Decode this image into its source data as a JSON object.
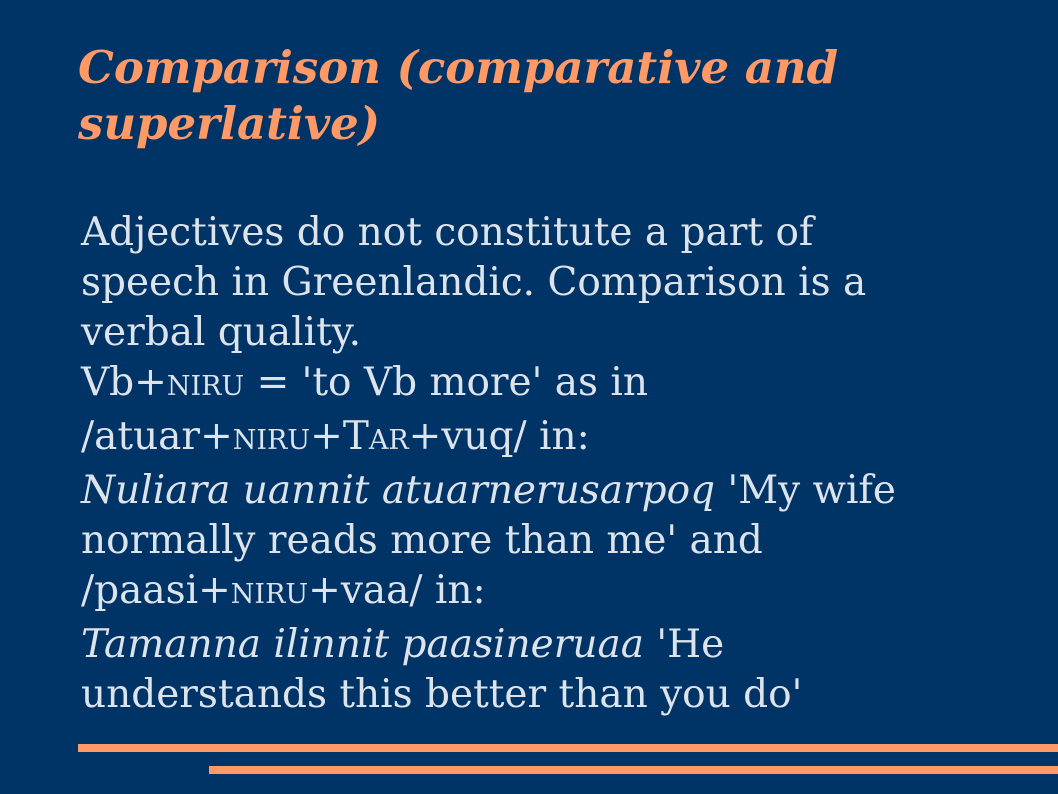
{
  "slide": {
    "title_line1": "Comparison (comparative and",
    "title_line2": "superlative)",
    "body": {
      "l1": "Adjectives do not constitute a part of",
      "l2": "speech in Greenlandic. Comparison is a",
      "l3": "verbal quality.",
      "l4": {
        "a": "Vb+",
        "b": "NIRU",
        "c": " = 'to Vb more' as in"
      },
      "l5": {
        "a": "/atuar+",
        "b": "NIRU",
        "c": "+T",
        "d": "AR",
        "e": "+vuq/ in:"
      },
      "l6": {
        "it": "Nuliara uannit atuarnerusarpoq",
        "rest": " 'My wife"
      },
      "l7": "normally reads more than me' and",
      "l8": {
        "a": "/paasi+",
        "b": "NIRU",
        "c": "+vaa/ in:"
      },
      "l9": {
        "it": "Tamanna ilinnit paasineruaa",
        "rest": " 'He"
      },
      "l10": "understands this better than you do'"
    }
  },
  "colors": {
    "background": "#003366",
    "accent": "#ff9966",
    "text": "#dde3ea"
  }
}
